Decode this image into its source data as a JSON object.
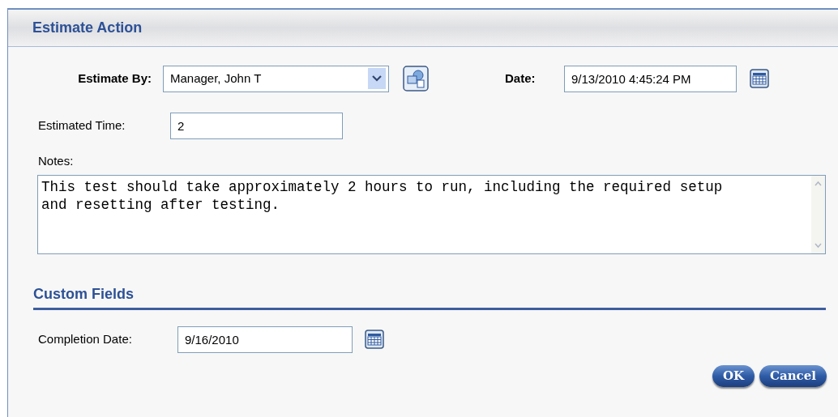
{
  "panel": {
    "title": "Estimate Action"
  },
  "estimate_by": {
    "label": "Estimate By:",
    "value": "Manager, John T"
  },
  "date": {
    "label": "Date:",
    "value": "9/13/2010 4:45:24 PM"
  },
  "estimated_time": {
    "label": "Estimated Time:",
    "value": "2"
  },
  "notes": {
    "label": "Notes:",
    "value": "This test should take approximately 2 hours to run, including the required setup and resetting after testing."
  },
  "custom_fields": {
    "title": "Custom Fields",
    "completion_date": {
      "label": "Completion Date:",
      "value": "9/16/2010"
    }
  },
  "buttons": [
    "OK",
    "Cancel"
  ]
}
